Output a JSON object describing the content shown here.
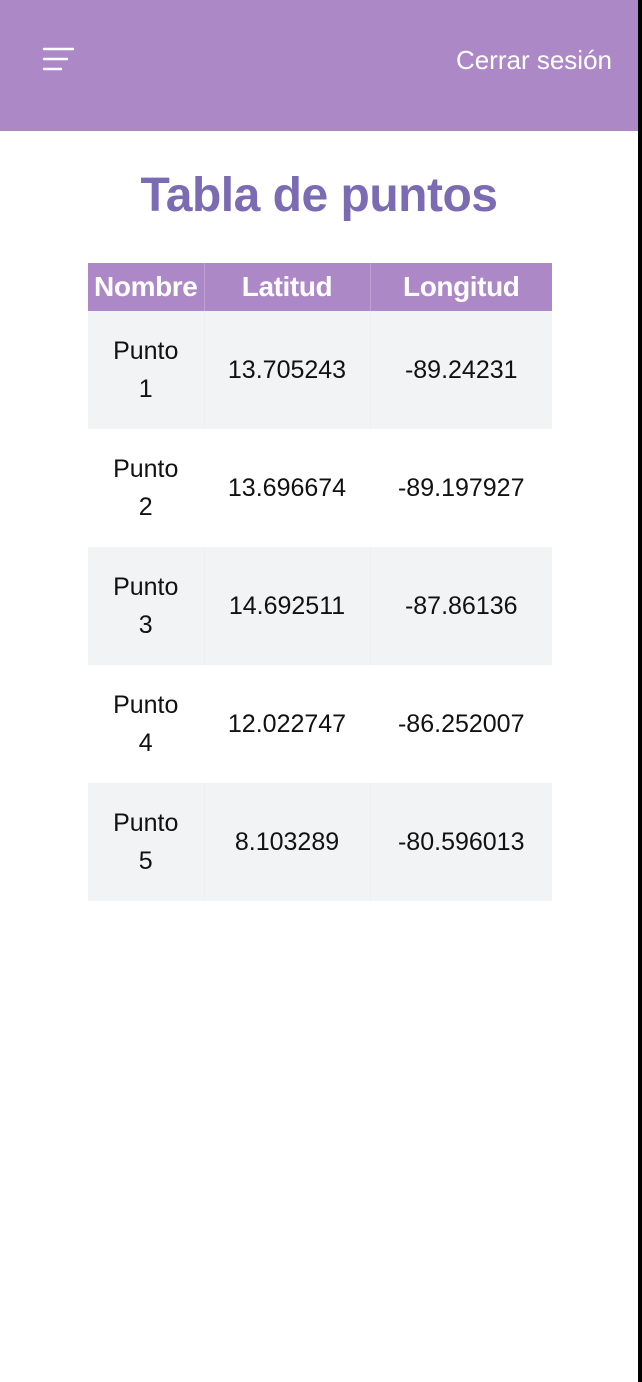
{
  "header": {
    "menu_icon": "hamburger-menu-icon",
    "logout_label": "Cerrar sesión",
    "bg_color": "#ad88c6"
  },
  "page": {
    "title": "Tabla de puntos",
    "title_color": "#7b6bb3"
  },
  "table": {
    "columns": [
      "Nombre",
      "Latitud",
      "Longitud"
    ],
    "rows": [
      {
        "name": "Punto 1",
        "lat": "13.705243",
        "lng": "-89.24231"
      },
      {
        "name": "Punto 2",
        "lat": "13.696674",
        "lng": "-89.197927"
      },
      {
        "name": "Punto 3",
        "lat": "14.692511",
        "lng": "-87.86136"
      },
      {
        "name": "Punto 4",
        "lat": "12.022747",
        "lng": "-86.252007"
      },
      {
        "name": "Punto 5",
        "lat": "8.103289",
        "lng": "-80.596013"
      }
    ]
  }
}
